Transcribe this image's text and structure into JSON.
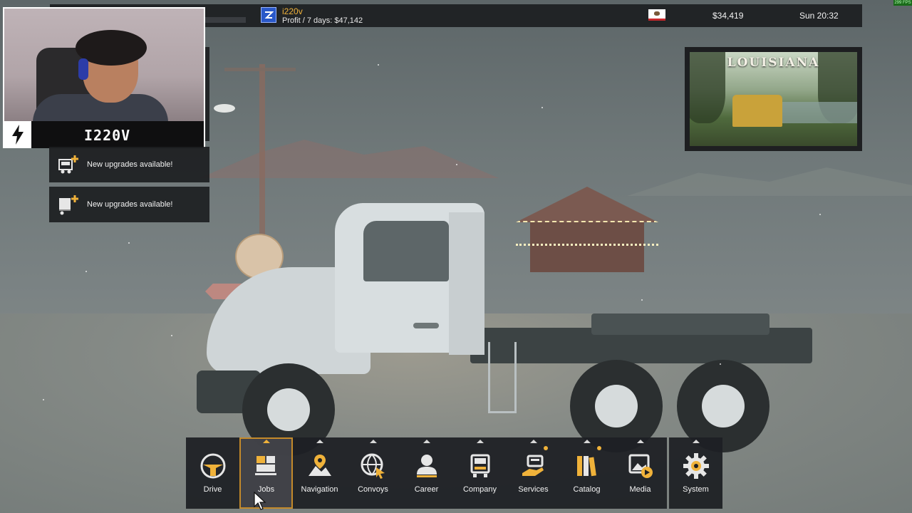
{
  "topbar": {
    "company_name": "i220v",
    "profit": "Profit / 7 days: $47,142",
    "money": "$34,419",
    "clock": "Sun 20:32",
    "fps": "299 FPS",
    "flag_icon": "california-flag-icon"
  },
  "webcam": {
    "streamer_name": "I220V"
  },
  "notifications": [
    {
      "icon": "truck-upgrade-icon",
      "text": "New upgrades available!"
    },
    {
      "icon": "trailer-upgrade-icon",
      "text": "New upgrades available!"
    }
  ],
  "location": {
    "title": "LOUISIANA"
  },
  "menu": {
    "items": [
      {
        "label": "Drive",
        "icon": "steering-wheel-icon",
        "active": false,
        "dot": false
      },
      {
        "label": "Jobs",
        "icon": "jobs-cargo-icon",
        "active": true,
        "dot": false
      },
      {
        "label": "Navigation",
        "icon": "map-pin-icon",
        "active": false,
        "dot": false
      },
      {
        "label": "Convoys",
        "icon": "globe-cursor-icon",
        "active": false,
        "dot": false
      },
      {
        "label": "Career",
        "icon": "person-icon",
        "active": false,
        "dot": false
      },
      {
        "label": "Company",
        "icon": "truck-front-icon",
        "active": false,
        "dot": false
      },
      {
        "label": "Services",
        "icon": "service-hand-icon",
        "active": false,
        "dot": true
      },
      {
        "label": "Catalog",
        "icon": "books-icon",
        "active": false,
        "dot": true
      },
      {
        "label": "Media",
        "icon": "media-photo-icon",
        "active": false,
        "dot": false
      }
    ],
    "system": {
      "label": "System",
      "icon": "gear-icon"
    }
  },
  "colors": {
    "accent": "#f0b23a",
    "panel": "#1e2024"
  }
}
